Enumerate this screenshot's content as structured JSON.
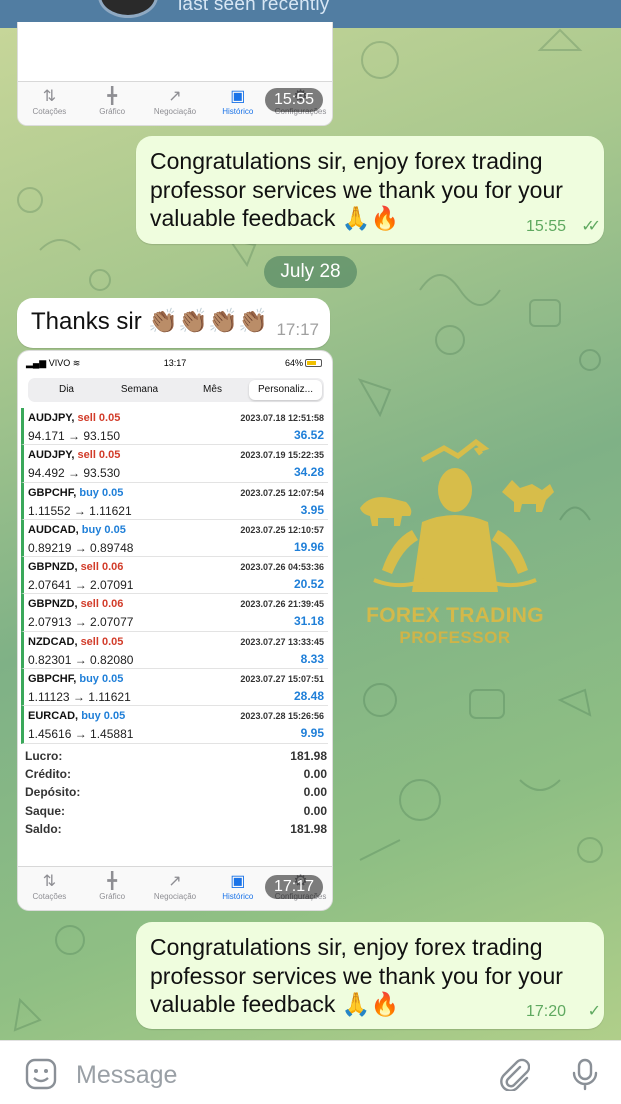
{
  "header": {
    "status": "last seen recently"
  },
  "screenshot_top": {
    "tabs": [
      {
        "label": "Cotações",
        "icon": "quotes-icon"
      },
      {
        "label": "Gráfico",
        "icon": "candles-icon"
      },
      {
        "label": "Negociação",
        "icon": "trade-icon"
      },
      {
        "label": "Histórico",
        "icon": "history-icon"
      },
      {
        "label": "Configurações",
        "icon": "gear-icon"
      }
    ],
    "time": "15:55"
  },
  "messages": {
    "reply1": {
      "lines": [
        "Congratulations sir, enjoy forex trading",
        "professor services we thank you for your",
        "valuable feedback 🙏🔥"
      ],
      "time": "15:55",
      "ticks": "✓✓"
    },
    "date": "July 28",
    "thanks": {
      "text": "Thanks sir 👏🏽👏🏽👏🏽👏🏽",
      "time": "17:17"
    },
    "reply2": {
      "lines": [
        "Congratulations sir, enjoy forex trading",
        "professor services we thank you for your",
        "valuable feedback 🙏🔥"
      ],
      "time": "17:20",
      "ticks": "✓"
    }
  },
  "screenshot_trades": {
    "status": {
      "carrier": "VIVO",
      "time": "13:17",
      "battery": "64%"
    },
    "segments": [
      "Dia",
      "Semana",
      "Mês",
      "Personaliz..."
    ],
    "trades": [
      {
        "symbol": "AUDJPY,",
        "side": "sell 0.05",
        "type": "sell",
        "prices": "94.171 → 93.150",
        "datetime": "2023.07.18 12:51:58",
        "profit": "36.52"
      },
      {
        "symbol": "AUDJPY,",
        "side": "sell 0.05",
        "type": "sell",
        "prices": "94.492 → 93.530",
        "datetime": "2023.07.19 15:22:35",
        "profit": "34.28"
      },
      {
        "symbol": "GBPCHF,",
        "side": "buy 0.05",
        "type": "buy",
        "prices": "1.11552 → 1.11621",
        "datetime": "2023.07.25 12:07:54",
        "profit": "3.95"
      },
      {
        "symbol": "AUDCAD,",
        "side": "buy 0.05",
        "type": "buy",
        "prices": "0.89219 → 0.89748",
        "datetime": "2023.07.25 12:10:57",
        "profit": "19.96"
      },
      {
        "symbol": "GBPNZD,",
        "side": "sell 0.06",
        "type": "sell",
        "prices": "2.07641 → 2.07091",
        "datetime": "2023.07.26 04:53:36",
        "profit": "20.52"
      },
      {
        "symbol": "GBPNZD,",
        "side": "sell 0.06",
        "type": "sell",
        "prices": "2.07913 → 2.07077",
        "datetime": "2023.07.26 21:39:45",
        "profit": "31.18"
      },
      {
        "symbol": "NZDCAD,",
        "side": "sell 0.05",
        "type": "sell",
        "prices": "0.82301 → 0.82080",
        "datetime": "2023.07.27 13:33:45",
        "profit": "8.33"
      },
      {
        "symbol": "GBPCHF,",
        "side": "buy 0.05",
        "type": "buy",
        "prices": "1.11123 → 1.11621",
        "datetime": "2023.07.27 15:07:51",
        "profit": "28.48"
      },
      {
        "symbol": "EURCAD,",
        "side": "buy 0.05",
        "type": "buy",
        "prices": "1.45616 → 1.45881",
        "datetime": "2023.07.28 15:26:56",
        "profit": "9.95"
      }
    ],
    "summary": [
      {
        "label": "Lucro:",
        "value": "181.98"
      },
      {
        "label": "Crédito:",
        "value": "0.00"
      },
      {
        "label": "Depósito:",
        "value": "0.00"
      },
      {
        "label": "Saque:",
        "value": "0.00"
      },
      {
        "label": "Saldo:",
        "value": "181.98"
      }
    ],
    "tabs": [
      {
        "label": "Cotações",
        "icon": "quotes-icon"
      },
      {
        "label": "Gráfico",
        "icon": "candles-icon"
      },
      {
        "label": "Negociação",
        "icon": "trade-icon"
      },
      {
        "label": "Histórico",
        "icon": "history-icon"
      },
      {
        "label": "Configurações",
        "icon": "gear-icon"
      }
    ],
    "time": "17:17"
  },
  "watermark": {
    "title": "FOREX TRADING",
    "subtitle": "PROFESSOR"
  },
  "composer": {
    "placeholder": "Message"
  },
  "colors": {
    "header": "#517da2",
    "outgoing": "#effdde",
    "buy": "#1f7fd8",
    "sell": "#d23c2a",
    "accent_green": "#5fa960",
    "logo_gold": "#d4b94a"
  }
}
